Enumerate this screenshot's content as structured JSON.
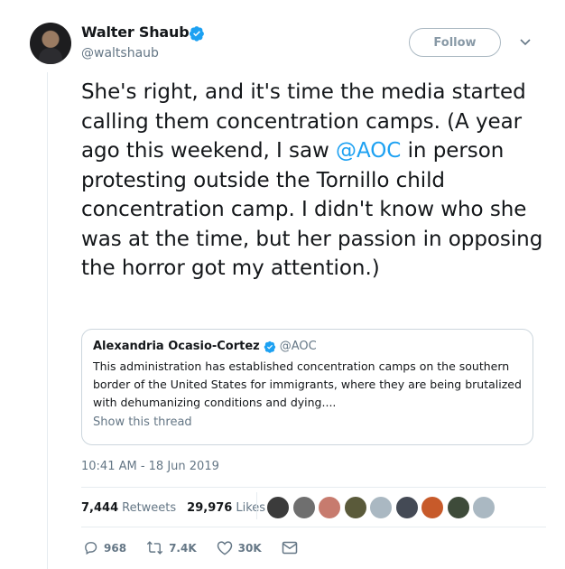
{
  "author": {
    "name": "Walter Shaub",
    "handle": "@waltshaub"
  },
  "follow_label": "Follow",
  "tweet": {
    "text_before": "She's right, and it's time the media started calling them concentration camps. (A year ago this weekend, I saw ",
    "mention": "@AOC",
    "text_after": " in person protesting outside the Tornillo child concentration camp. I didn't know who she was at the time, but her passion in opposing the horror got my attention.)"
  },
  "quoted": {
    "name": "Alexandria Ocasio-Cortez",
    "handle": "@AOC",
    "text": "This administration has established concentration camps on the southern border of the United States for immigrants, where they are being brutalized with dehumanizing conditions and dying....",
    "show_thread": "Show this thread"
  },
  "timestamp": "10:41 AM - 18 Jun 2019",
  "stats": {
    "retweets_count": "7,444",
    "retweets_label": "Retweets",
    "likes_count": "29,976",
    "likes_label": "Likes"
  },
  "likers": [
    "#3b3b3b",
    "#6f6f6f",
    "#c77b6e",
    "#5a5a3a",
    "#aab8c2",
    "#444a55",
    "#c75a2a",
    "#3e4b3a",
    "#aab8c2"
  ],
  "actions": {
    "reply_count": "968",
    "retweet_count": "7.4K",
    "like_count": "30K"
  },
  "colors": {
    "link": "#1da1f2",
    "muted": "#657786",
    "text": "#14171a"
  }
}
